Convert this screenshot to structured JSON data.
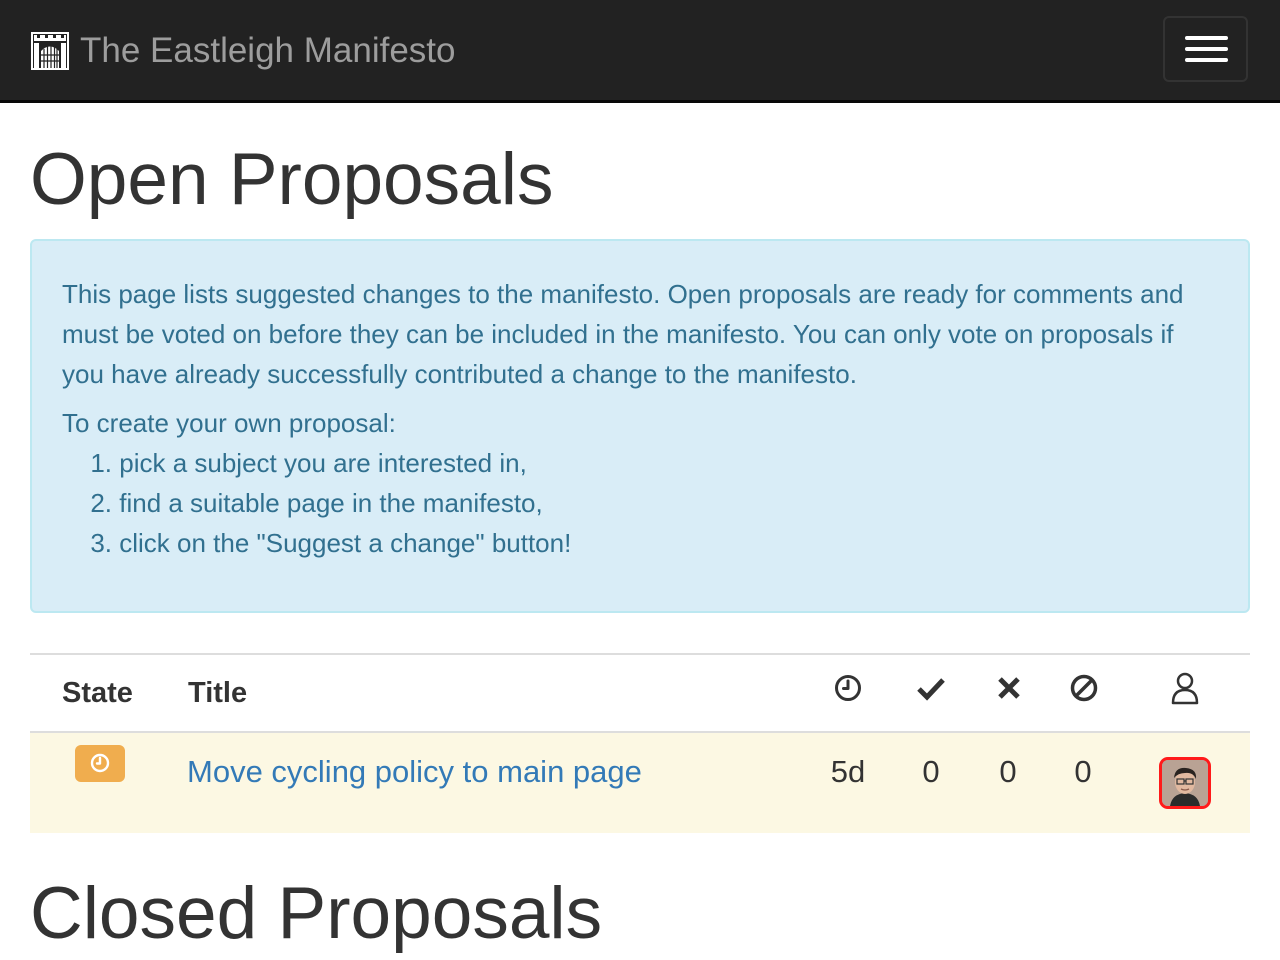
{
  "navbar": {
    "brand_text": "The Eastleigh Manifesto",
    "logo_icon": "castle-gate-logo",
    "menu_icon": "hamburger-menu-icon"
  },
  "open_section": {
    "heading": "Open Proposals"
  },
  "info_panel": {
    "paragraph": "This page lists suggested changes to the manifesto. Open proposals are ready for comments and must be voted on before they can be included in the manifesto. You can only vote on proposals if you have already successfully contributed a change to the manifesto.",
    "create_intro": "To create your own proposal:",
    "steps": [
      {
        "num": "1.",
        "text": "pick a subject you are interested in,"
      },
      {
        "num": "2.",
        "text": "find a suitable page in the manifesto,"
      },
      {
        "num": "3.",
        "text": "click on the \"Suggest a change\" button!"
      }
    ]
  },
  "table": {
    "headers": {
      "state": "State",
      "title": "Title",
      "time_icon": "clock-icon",
      "yes_icon": "checkmark-icon",
      "no_icon": "cross-icon",
      "abstain_icon": "abstain-icon",
      "author_icon": "user-icon"
    },
    "rows": [
      {
        "state_icon": "clock-icon",
        "title": "Move cycling policy to main page",
        "time": "5d",
        "yes": "0",
        "no": "0",
        "abstain": "0",
        "author_avatar": "user-avatar"
      }
    ]
  },
  "closed_section": {
    "heading": "Closed Proposals"
  },
  "colors": {
    "navbar_bg": "#222222",
    "info_bg": "#d9edf7",
    "info_text": "#31708f",
    "row_highlight": "#fcf8e3",
    "state_badge": "#f0ad4e",
    "link": "#337ab7",
    "avatar_border": "#ff1a1a"
  }
}
